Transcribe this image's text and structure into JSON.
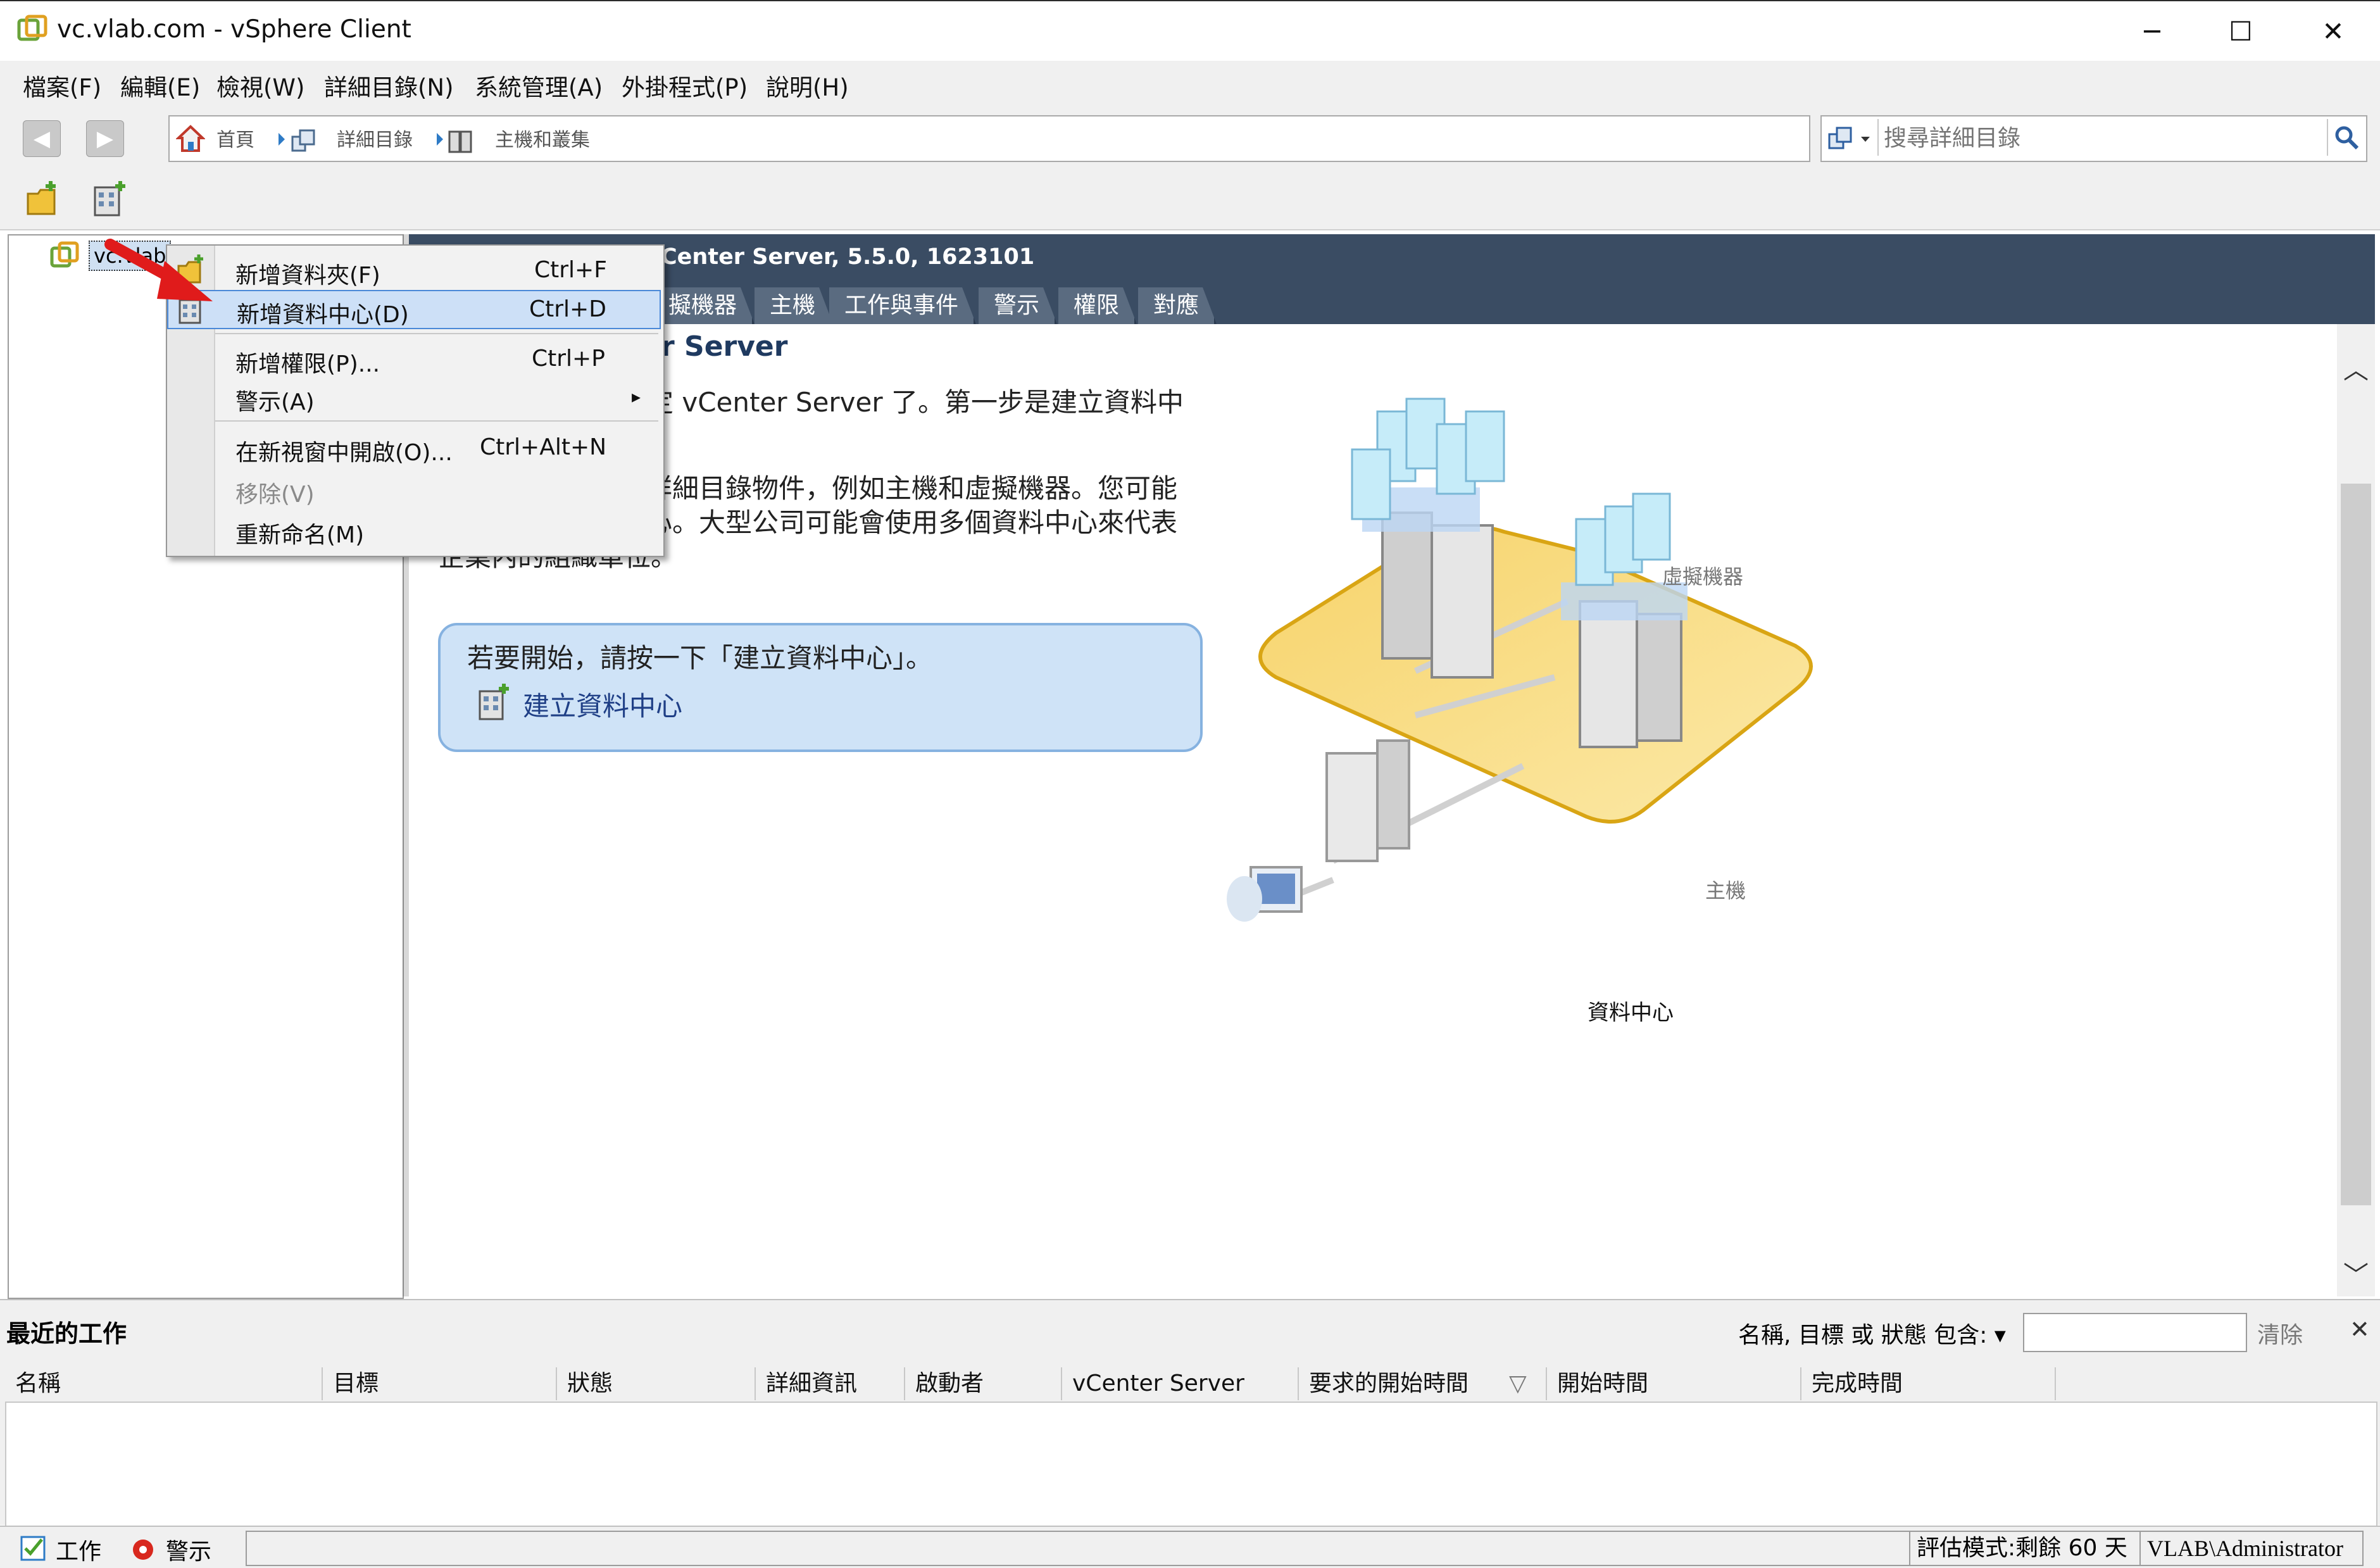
{
  "window": {
    "title": "vc.vlab.com - vSphere Client",
    "minimize": "─",
    "maximize": "☐",
    "close": "✕"
  },
  "menu": [
    "檔案(F)",
    "編輯(E)",
    "檢視(W)",
    "詳細目錄(N)",
    "系統管理(A)",
    "外掛程式(P)",
    "說明(H)"
  ],
  "breadcrumb": [
    "首頁",
    "詳細目錄",
    "主機和叢集"
  ],
  "search": {
    "placeholder": "搜尋詳細目錄"
  },
  "tree": {
    "root_label": "vc.vlab"
  },
  "header": {
    "server_info": "Center Server, 5.5.0, 1623101",
    "tabs": [
      "擬機器",
      "主機",
      "工作與事件",
      "警示",
      "權限",
      "對應"
    ]
  },
  "content": {
    "heading": "r Server",
    "para1": "定 vCenter Server 了。第一步是建立資料中",
    "para2_line1": "詳細目錄物件，例如主機和虛擬機器。您可能",
    "para2_line2": "心。大型公司可能會使用多個資料中心來代表",
    "para2_line3": "企業內的組織單位。",
    "callout_text": "若要開始，請按一下「建立資料中心」。",
    "callout_link": "建立資料中心"
  },
  "diagram": {
    "vm_label": "虛擬機器",
    "host_label": "主機",
    "datacenter_label": "資料中心"
  },
  "context_menu": {
    "items": [
      {
        "label": "新增資料夾(F)",
        "shortcut": "Ctrl+F"
      },
      {
        "label": "新增資料中心(D)",
        "shortcut": "Ctrl+D"
      },
      {
        "label": "新增權限(P)...",
        "shortcut": "Ctrl+P"
      },
      {
        "label": "警示(A)",
        "shortcut": "▸"
      },
      {
        "label": "在新視窗中開啟(O)...",
        "shortcut": "Ctrl+Alt+N"
      },
      {
        "label": "移除(V)",
        "shortcut": ""
      },
      {
        "label": "重新命名(M)",
        "shortcut": ""
      }
    ]
  },
  "recent_tasks": {
    "title": "最近的工作",
    "filter_label": "名稱, 目標 或 狀態 包含: ▾",
    "clear": "清除",
    "close": "✕",
    "columns": [
      "名稱",
      "目標",
      "狀態",
      "詳細資訊",
      "啟動者",
      "vCenter Server",
      "要求的開始時間",
      "開始時間",
      "完成時間"
    ],
    "sort_indicator": "▽"
  },
  "statusbar": {
    "tasks": "工作",
    "alarms": "警示",
    "eval": "評估模式:剩餘 60 天",
    "user": "VLAB\\Administrator"
  },
  "colors": {
    "header_bg": "#3a4c63",
    "callout_bg": "#cfe3f7",
    "highlight": "#cde0f7",
    "link": "#1f3f86",
    "arrow": "#e01b1b"
  }
}
